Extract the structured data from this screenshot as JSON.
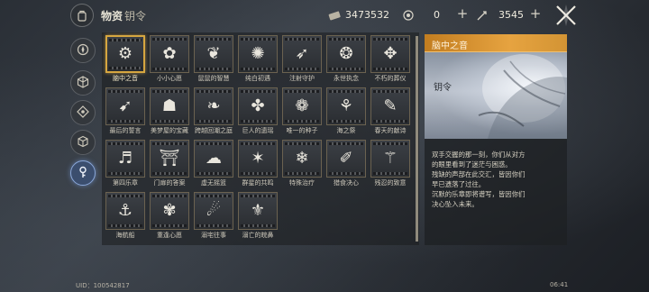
{
  "header": {
    "title": "物资",
    "subtitle": "钥令",
    "gold": "3473532",
    "currency_two": "0",
    "currency_three": "3545",
    "home_icon": "backpack-icon",
    "close_icon": "crossed-swords-icon"
  },
  "sidebar": {
    "items": [
      {
        "icon": "compass-icon",
        "active": false
      },
      {
        "icon": "hexagon-cube-icon",
        "active": false
      },
      {
        "icon": "diamond-target-icon",
        "active": false
      },
      {
        "icon": "box-icon",
        "active": false
      },
      {
        "icon": "key-icon",
        "active": true
      }
    ]
  },
  "items": [
    {
      "label": "脑中之音",
      "icon": "⚙"
    },
    {
      "label": "小小心愿",
      "icon": "✿"
    },
    {
      "label": "鼠鼠的智慧",
      "icon": "❦"
    },
    {
      "label": "纯白初遇",
      "icon": "✺"
    },
    {
      "label": "注射守护",
      "icon": "➶"
    },
    {
      "label": "永世执念",
      "icon": "❂"
    },
    {
      "label": "不朽的葬仪",
      "icon": "✥"
    },
    {
      "label": "最后的誓言",
      "icon": "➹"
    },
    {
      "label": "美梦屋的宝藏",
      "icon": "☗"
    },
    {
      "label": "跨越回潮之庭",
      "icon": "❧"
    },
    {
      "label": "巨人的遗瑶",
      "icon": "✤"
    },
    {
      "label": "唯一的种子",
      "icon": "❁"
    },
    {
      "label": "海之祭",
      "icon": "⚘"
    },
    {
      "label": "春天的献诗",
      "icon": "✎"
    },
    {
      "label": "第四乐章",
      "icon": "♬"
    },
    {
      "label": "门扉的答案",
      "icon": "⛩"
    },
    {
      "label": "虚无摇篮",
      "icon": "☁"
    },
    {
      "label": "群星的共鸣",
      "icon": "✶"
    },
    {
      "label": "特殊治疗",
      "icon": "❄"
    },
    {
      "label": "猎食决心",
      "icon": "✐"
    },
    {
      "label": "残忍的致意",
      "icon": "⚚"
    },
    {
      "label": "海航船",
      "icon": "⚓"
    },
    {
      "label": "重逢心愿",
      "icon": "✾"
    },
    {
      "label": "溺宅往事",
      "icon": "☄"
    },
    {
      "label": "溺亡的皖鼻",
      "icon": "⚜"
    }
  ],
  "selected_index": 0,
  "detail": {
    "title": "脑中之音",
    "category": "钥令",
    "description": [
      "双手交握的那一刻，你们从对方",
      "的眼里看到了迷茫与困惑。",
      "残缺的声部在此交汇，皆因你们",
      "早已遗落了过往。",
      "沉默的乐章即将谱写，皆因你们",
      "决心坠入未来。"
    ]
  },
  "footer": {
    "uid": "UID：100542817",
    "time": "06:41"
  },
  "colors": {
    "accent_gold": "#d6a640",
    "header_orange": "#e6a340",
    "active_blue": "#8aa7d8"
  }
}
